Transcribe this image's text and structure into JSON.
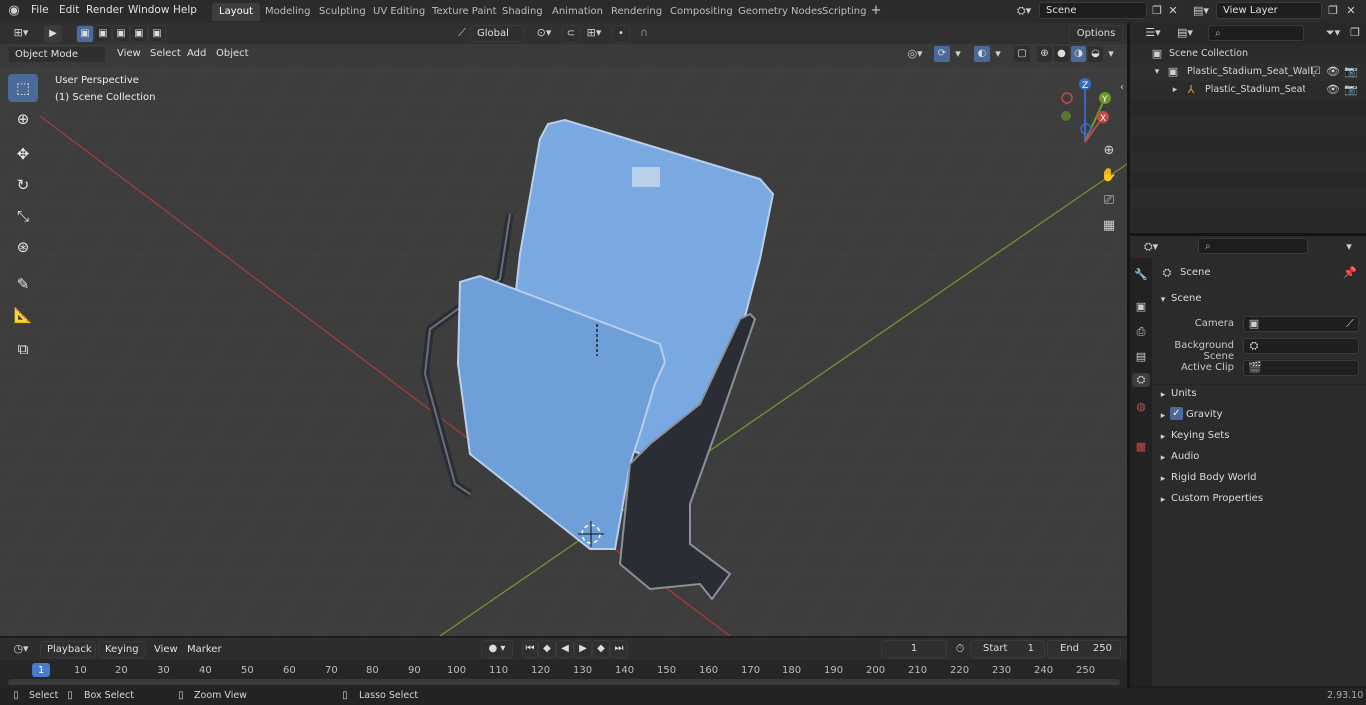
{
  "menu": {
    "items": [
      "File",
      "Edit",
      "Render",
      "Window",
      "Help"
    ]
  },
  "workspaces": [
    "Layout",
    "Modeling",
    "Sculpting",
    "UV Editing",
    "Texture Paint",
    "Shading",
    "Animation",
    "Rendering",
    "Compositing",
    "Geometry Nodes",
    "Scripting"
  ],
  "active_workspace": "Layout",
  "scene_field": "Scene",
  "view_layer_field": "View Layer",
  "viewport_header": {
    "mode": "Object Mode",
    "menus": [
      "View",
      "Select",
      "Add",
      "Object"
    ],
    "transform_orientation": "Global",
    "options_label": "Options"
  },
  "viewport": {
    "perspective_label": "User Perspective",
    "collection_label": "(1) Scene Collection",
    "gizmo_axes": [
      "Z",
      "Y",
      "X"
    ]
  },
  "outliner": {
    "root": "Scene Collection",
    "items": [
      {
        "label": "Plastic_Stadium_Seat_Wall_M",
        "level": 1
      },
      {
        "label": "Plastic_Stadium_Seat_Wa",
        "level": 2
      }
    ]
  },
  "properties": {
    "header": "Scene",
    "panel_title": "Scene",
    "fields": [
      {
        "label": "Camera"
      },
      {
        "label": "Background Scene"
      },
      {
        "label": "Active Clip"
      }
    ],
    "sections": [
      "Units",
      "Gravity",
      "Keying Sets",
      "Audio",
      "Rigid Body World",
      "Custom Properties"
    ]
  },
  "timeline": {
    "menus": [
      "Playback",
      "Keying",
      "View",
      "Marker"
    ],
    "current_frame": "1",
    "start_label": "Start",
    "start_value": "1",
    "end_label": "End",
    "end_value": "250",
    "ticks": [
      "1",
      "10",
      "20",
      "30",
      "40",
      "50",
      "60",
      "70",
      "80",
      "90",
      "100",
      "110",
      "120",
      "130",
      "140",
      "150",
      "160",
      "170",
      "180",
      "190",
      "200",
      "210",
      "220",
      "230",
      "240",
      "250"
    ]
  },
  "statusbar": {
    "items": [
      "Select",
      "Box Select",
      "Zoom View",
      "Lasso Select"
    ],
    "version": "2.93.10"
  },
  "colors": {
    "accent": "#4a6a9a",
    "seat": "#7aa8e0",
    "x_axis": "#a83a3a",
    "y_axis": "#6a9a2a"
  }
}
